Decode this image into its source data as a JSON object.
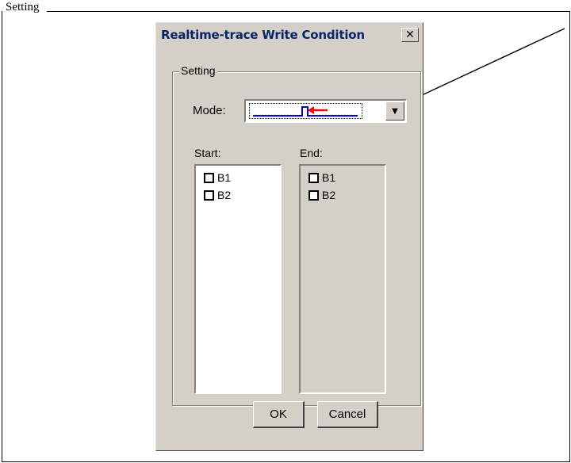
{
  "doc": {
    "top_text": "Setting"
  },
  "dialog": {
    "title": "Realtime-trace Write Condition",
    "close_glyph": "✕",
    "group_label": "Setting",
    "mode_label": "Mode:",
    "dropdown_glyph": "▼",
    "start_label": "Start:",
    "end_label": "End:",
    "start_items": [
      {
        "label": "B1",
        "checked": false
      },
      {
        "label": "B2",
        "checked": false
      }
    ],
    "end_items": [
      {
        "label": "B1",
        "checked": false
      },
      {
        "label": "B2",
        "checked": false
      }
    ],
    "ok_label": "OK",
    "cancel_label": "Cancel"
  },
  "icons": {
    "close": "close-icon",
    "dropdown": "chevron-down-icon",
    "mode_glyph": "trace-waveform-icon",
    "callout": "annotation-arrow"
  },
  "colors": {
    "title_text": "#0a246a",
    "waveform": "#0000cc",
    "waveform_arrow": "#ff0000",
    "dialog_bg": "#d4d0c8"
  }
}
